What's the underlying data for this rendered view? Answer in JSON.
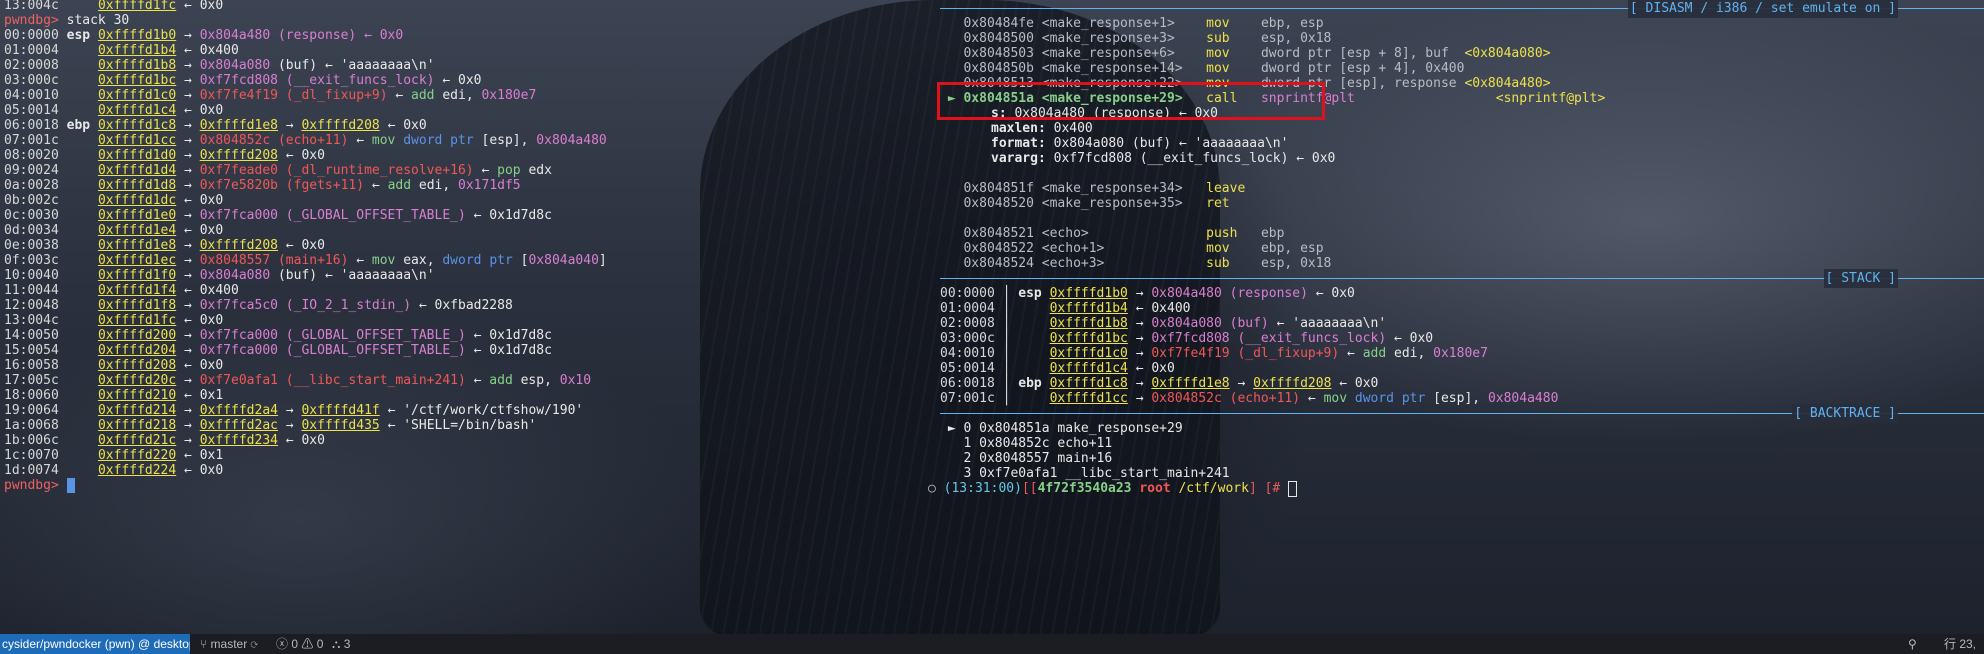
{
  "left_panel": {
    "top_line": {
      "idx": "13:004c",
      "addr": "0xffffd1fc",
      "rest": " ← 0x0"
    },
    "prompt": "pwndbg>",
    "command": " stack 30",
    "prompt2": "pwndbg>",
    "rows": [
      {
        "idx": "00:0000",
        "reg": "esp",
        "addr": "0xffffd1b0",
        "parts": [
          {
            "t": " → ",
            "c": "wf"
          },
          {
            "t": "0x804a480",
            "c": "pk"
          },
          {
            "t": " (response) ← 0x0",
            "c": "pk"
          }
        ]
      },
      {
        "idx": "01:0004",
        "reg": "",
        "addr": "0xffffd1b4",
        "parts": [
          {
            "t": " ← 0x400",
            "c": "wf"
          }
        ]
      },
      {
        "idx": "02:0008",
        "reg": "",
        "addr": "0xffffd1b8",
        "parts": [
          {
            "t": " → ",
            "c": "wf"
          },
          {
            "t": "0x804a080",
            "c": "pk"
          },
          {
            "t": " (buf) ← 'aaaaaaaa\\n'",
            "c": "wf"
          }
        ]
      },
      {
        "idx": "03:000c",
        "reg": "",
        "addr": "0xffffd1bc",
        "parts": [
          {
            "t": " → ",
            "c": "wf"
          },
          {
            "t": "0xf7fcd808 (__exit_funcs_lock)",
            "c": "pk"
          },
          {
            "t": " ← 0x0",
            "c": "wf"
          }
        ]
      },
      {
        "idx": "04:0010",
        "reg": "",
        "addr": "0xffffd1c0",
        "parts": [
          {
            "t": " → ",
            "c": "wf"
          },
          {
            "t": "0xf7fe4f19 (_dl_fixup+9)",
            "c": "rd"
          },
          {
            "t": " ← ",
            "c": "wf"
          },
          {
            "t": "add ",
            "c": "gn"
          },
          {
            "t": "edi, ",
            "c": "wf"
          },
          {
            "t": "0x180e7",
            "c": "pk"
          }
        ]
      },
      {
        "idx": "05:0014",
        "reg": "",
        "addr": "0xffffd1c4",
        "parts": [
          {
            "t": " ← 0x0",
            "c": "wf"
          }
        ]
      },
      {
        "idx": "06:0018",
        "reg": "ebp",
        "addr": "0xffffd1c8",
        "parts": [
          {
            "t": " → ",
            "c": "wf"
          },
          {
            "t": "0xffffd1e8",
            "c": "yl ul"
          },
          {
            "t": " → ",
            "c": "wf"
          },
          {
            "t": "0xffffd208",
            "c": "yl ul"
          },
          {
            "t": " ← 0x0",
            "c": "wf"
          }
        ]
      },
      {
        "idx": "07:001c",
        "reg": "",
        "addr": "0xffffd1cc",
        "parts": [
          {
            "t": " → ",
            "c": "wf"
          },
          {
            "t": "0x804852c (echo+11)",
            "c": "rd"
          },
          {
            "t": " ← ",
            "c": "wf"
          },
          {
            "t": "mov ",
            "c": "gn"
          },
          {
            "t": "dword ptr ",
            "c": "bl"
          },
          {
            "t": "[esp], ",
            "c": "wf"
          },
          {
            "t": "0x804a480",
            "c": "pk"
          }
        ]
      },
      {
        "idx": "08:0020",
        "reg": "",
        "addr": "0xffffd1d0",
        "parts": [
          {
            "t": " → ",
            "c": "wf"
          },
          {
            "t": "0xffffd208",
            "c": "yl ul"
          },
          {
            "t": " ← 0x0",
            "c": "wf"
          }
        ]
      },
      {
        "idx": "09:0024",
        "reg": "",
        "addr": "0xffffd1d4",
        "parts": [
          {
            "t": " → ",
            "c": "wf"
          },
          {
            "t": "0xf7feade0 (_dl_runtime_resolve+16)",
            "c": "rd"
          },
          {
            "t": " ← ",
            "c": "wf"
          },
          {
            "t": "pop ",
            "c": "gn"
          },
          {
            "t": "edx",
            "c": "wf"
          }
        ]
      },
      {
        "idx": "0a:0028",
        "reg": "",
        "addr": "0xffffd1d8",
        "parts": [
          {
            "t": " → ",
            "c": "wf"
          },
          {
            "t": "0xf7e5820b (fgets+11)",
            "c": "rd"
          },
          {
            "t": " ← ",
            "c": "wf"
          },
          {
            "t": "add ",
            "c": "gn"
          },
          {
            "t": "edi, ",
            "c": "wf"
          },
          {
            "t": "0x171df5",
            "c": "pk"
          }
        ]
      },
      {
        "idx": "0b:002c",
        "reg": "",
        "addr": "0xffffd1dc",
        "parts": [
          {
            "t": " ← 0x0",
            "c": "wf"
          }
        ]
      },
      {
        "idx": "0c:0030",
        "reg": "",
        "addr": "0xffffd1e0",
        "parts": [
          {
            "t": " → ",
            "c": "wf"
          },
          {
            "t": "0xf7fca000 (_GLOBAL_OFFSET_TABLE_)",
            "c": "pk"
          },
          {
            "t": " ← 0x1d7d8c",
            "c": "wf"
          }
        ]
      },
      {
        "idx": "0d:0034",
        "reg": "",
        "addr": "0xffffd1e4",
        "parts": [
          {
            "t": " ← 0x0",
            "c": "wf"
          }
        ]
      },
      {
        "idx": "0e:0038",
        "reg": "",
        "addr": "0xffffd1e8",
        "parts": [
          {
            "t": " → ",
            "c": "wf"
          },
          {
            "t": "0xffffd208",
            "c": "yl ul"
          },
          {
            "t": " ← 0x0",
            "c": "wf"
          }
        ]
      },
      {
        "idx": "0f:003c",
        "reg": "",
        "addr": "0xffffd1ec",
        "parts": [
          {
            "t": " → ",
            "c": "wf"
          },
          {
            "t": "0x8048557 (main+16)",
            "c": "rd"
          },
          {
            "t": " ← ",
            "c": "wf"
          },
          {
            "t": "mov ",
            "c": "gn"
          },
          {
            "t": "eax, ",
            "c": "wf"
          },
          {
            "t": "dword ptr ",
            "c": "bl"
          },
          {
            "t": "[",
            "c": "wf"
          },
          {
            "t": "0x804a040",
            "c": "pk"
          },
          {
            "t": "]",
            "c": "wf"
          }
        ]
      },
      {
        "idx": "10:0040",
        "reg": "",
        "addr": "0xffffd1f0",
        "parts": [
          {
            "t": " → ",
            "c": "wf"
          },
          {
            "t": "0x804a080",
            "c": "pk"
          },
          {
            "t": " (buf) ← 'aaaaaaaa\\n'",
            "c": "wf"
          }
        ]
      },
      {
        "idx": "11:0044",
        "reg": "",
        "addr": "0xffffd1f4",
        "parts": [
          {
            "t": " ← 0x400",
            "c": "wf"
          }
        ]
      },
      {
        "idx": "12:0048",
        "reg": "",
        "addr": "0xffffd1f8",
        "parts": [
          {
            "t": " → ",
            "c": "wf"
          },
          {
            "t": "0xf7fca5c0 (_IO_2_1_stdin_)",
            "c": "pk"
          },
          {
            "t": " ← 0xfbad2288",
            "c": "wf"
          }
        ]
      },
      {
        "idx": "13:004c",
        "reg": "",
        "addr": "0xffffd1fc",
        "parts": [
          {
            "t": " ← 0x0",
            "c": "wf"
          }
        ]
      },
      {
        "idx": "14:0050",
        "reg": "",
        "addr": "0xffffd200",
        "parts": [
          {
            "t": " → ",
            "c": "wf"
          },
          {
            "t": "0xf7fca000 (_GLOBAL_OFFSET_TABLE_)",
            "c": "pk"
          },
          {
            "t": " ← 0x1d7d8c",
            "c": "wf"
          }
        ]
      },
      {
        "idx": "15:0054",
        "reg": "",
        "addr": "0xffffd204",
        "parts": [
          {
            "t": " → ",
            "c": "wf"
          },
          {
            "t": "0xf7fca000 (_GLOBAL_OFFSET_TABLE_)",
            "c": "pk"
          },
          {
            "t": " ← 0x1d7d8c",
            "c": "wf"
          }
        ]
      },
      {
        "idx": "16:0058",
        "reg": "",
        "addr": "0xffffd208",
        "parts": [
          {
            "t": " ← 0x0",
            "c": "wf"
          }
        ]
      },
      {
        "idx": "17:005c",
        "reg": "",
        "addr": "0xffffd20c",
        "parts": [
          {
            "t": " → ",
            "c": "wf"
          },
          {
            "t": "0xf7e0afa1 (__libc_start_main+241)",
            "c": "rd"
          },
          {
            "t": " ← ",
            "c": "wf"
          },
          {
            "t": "add ",
            "c": "gn"
          },
          {
            "t": "esp, ",
            "c": "wf"
          },
          {
            "t": "0x10",
            "c": "pk"
          }
        ]
      },
      {
        "idx": "18:0060",
        "reg": "",
        "addr": "0xffffd210",
        "parts": [
          {
            "t": " ← 0x1",
            "c": "wf"
          }
        ]
      },
      {
        "idx": "19:0064",
        "reg": "",
        "addr": "0xffffd214",
        "parts": [
          {
            "t": " → ",
            "c": "wf"
          },
          {
            "t": "0xffffd2a4",
            "c": "yl ul"
          },
          {
            "t": " → ",
            "c": "wf"
          },
          {
            "t": "0xffffd41f",
            "c": "yl ul"
          },
          {
            "t": " ← '/ctf/work/ctfshow/190'",
            "c": "wf"
          }
        ]
      },
      {
        "idx": "1a:0068",
        "reg": "",
        "addr": "0xffffd218",
        "parts": [
          {
            "t": " → ",
            "c": "wf"
          },
          {
            "t": "0xffffd2ac",
            "c": "yl ul"
          },
          {
            "t": " → ",
            "c": "wf"
          },
          {
            "t": "0xffffd435",
            "c": "yl ul"
          },
          {
            "t": " ← 'SHELL=/bin/bash'",
            "c": "wf"
          }
        ]
      },
      {
        "idx": "1b:006c",
        "reg": "",
        "addr": "0xffffd21c",
        "parts": [
          {
            "t": " → ",
            "c": "wf"
          },
          {
            "t": "0xffffd234",
            "c": "yl ul"
          },
          {
            "t": " ← 0x0",
            "c": "wf"
          }
        ]
      },
      {
        "idx": "1c:0070",
        "reg": "",
        "addr": "0xffffd220",
        "parts": [
          {
            "t": " ← 0x1",
            "c": "wf"
          }
        ]
      },
      {
        "idx": "1d:0074",
        "reg": "",
        "addr": "0xffffd224",
        "parts": [
          {
            "t": " ← 0x0",
            "c": "wf"
          }
        ]
      }
    ]
  },
  "right_panel": {
    "disasm_header": "[ DISASM / i386 / set emulate on ]",
    "disasm_rows": [
      {
        "marker": "",
        "addr": "0x80484fe",
        "sym": "<make_response+1>",
        "mn": "mov",
        "ops": "ebp, esp",
        "tgt": "",
        "current": false
      },
      {
        "marker": "",
        "addr": "0x8048500",
        "sym": "<make_response+3>",
        "mn": "sub",
        "ops": "esp, 0x18",
        "tgt": "",
        "current": false
      },
      {
        "marker": "",
        "addr": "0x8048503",
        "sym": "<make_response+6>",
        "mn": "mov",
        "ops": "dword ptr [esp + 8], buf",
        "tgt": "<0x804a080>",
        "current": false
      },
      {
        "marker": "",
        "addr": "0x804850b",
        "sym": "<make_response+14>",
        "mn": "mov",
        "ops": "dword ptr [esp + 4], 0x400",
        "tgt": "",
        "current": false
      },
      {
        "marker": "",
        "addr": "0x8048513",
        "sym": "<make_response+22>",
        "mn": "mov",
        "ops": "dword ptr [esp], response",
        "tgt": "<0x804a480>",
        "current": false
      },
      {
        "marker": "►",
        "addr": "0x804851a",
        "sym": "<make_response+29>",
        "mn": "call",
        "ops": "snprintf@plt",
        "tgt": "<snprintf@plt>",
        "current": true
      }
    ],
    "call_args": [
      {
        "name": "s:",
        "val": " 0x804a480 (response) ← 0x0"
      },
      {
        "name": "maxlen:",
        "val": " 0x400"
      },
      {
        "name": "format:",
        "val": " 0x804a080 (buf) ← 'aaaaaaaa\\n'"
      },
      {
        "name": "vararg:",
        "val": " 0xf7fcd808 (__exit_funcs_lock) ← 0x0"
      }
    ],
    "disasm_rows2": [
      {
        "addr": "0x804851f",
        "sym": "<make_response+34>",
        "mn": "leave",
        "ops": ""
      },
      {
        "addr": "0x8048520",
        "sym": "<make_response+35>",
        "mn": "ret",
        "ops": ""
      }
    ],
    "disasm_rows3": [
      {
        "addr": "0x8048521",
        "sym": "<echo>",
        "mn": "push",
        "ops": "ebp"
      },
      {
        "addr": "0x8048522",
        "sym": "<echo+1>",
        "mn": "mov",
        "ops": "ebp, esp"
      },
      {
        "addr": "0x8048524",
        "sym": "<echo+3>",
        "mn": "sub",
        "ops": "esp, 0x18"
      }
    ],
    "stack_header": "[ STACK ]",
    "stack_rows": [
      {
        "idx": "00:0000",
        "reg": "esp",
        "addr": "0xffffd1b0",
        "parts": [
          {
            "t": " → ",
            "c": "wf"
          },
          {
            "t": "0x804a480 (response)",
            "c": "pk"
          },
          {
            "t": " ← 0x0",
            "c": "wf"
          }
        ]
      },
      {
        "idx": "01:0004",
        "reg": "",
        "addr": "0xffffd1b4",
        "parts": [
          {
            "t": " ← 0x400",
            "c": "wf"
          }
        ]
      },
      {
        "idx": "02:0008",
        "reg": "",
        "addr": "0xffffd1b8",
        "parts": [
          {
            "t": " → ",
            "c": "wf"
          },
          {
            "t": "0x804a080 (buf)",
            "c": "pk"
          },
          {
            "t": " ← 'aaaaaaaa\\n'",
            "c": "wf"
          }
        ]
      },
      {
        "idx": "03:000c",
        "reg": "",
        "addr": "0xffffd1bc",
        "parts": [
          {
            "t": " → ",
            "c": "wf"
          },
          {
            "t": "0xf7fcd808 (__exit_funcs_lock)",
            "c": "pk"
          },
          {
            "t": " ← 0x0",
            "c": "wf"
          }
        ]
      },
      {
        "idx": "04:0010",
        "reg": "",
        "addr": "0xffffd1c0",
        "parts": [
          {
            "t": " → ",
            "c": "wf"
          },
          {
            "t": "0xf7fe4f19 (_dl_fixup+9)",
            "c": "rd"
          },
          {
            "t": " ← ",
            "c": "wf"
          },
          {
            "t": "add ",
            "c": "gn"
          },
          {
            "t": "edi, ",
            "c": "wf"
          },
          {
            "t": "0x180e7",
            "c": "pk"
          }
        ]
      },
      {
        "idx": "05:0014",
        "reg": "",
        "addr": "0xffffd1c4",
        "parts": [
          {
            "t": " ← 0x0",
            "c": "wf"
          }
        ]
      },
      {
        "idx": "06:0018",
        "reg": "ebp",
        "addr": "0xffffd1c8",
        "parts": [
          {
            "t": " → ",
            "c": "wf"
          },
          {
            "t": "0xffffd1e8",
            "c": "yl ul"
          },
          {
            "t": " → ",
            "c": "wf"
          },
          {
            "t": "0xffffd208",
            "c": "yl ul"
          },
          {
            "t": " ← 0x0",
            "c": "wf"
          }
        ]
      },
      {
        "idx": "07:001c",
        "reg": "",
        "addr": "0xffffd1cc",
        "parts": [
          {
            "t": " → ",
            "c": "wf"
          },
          {
            "t": "0x804852c (echo+11)",
            "c": "rd"
          },
          {
            "t": " ← ",
            "c": "wf"
          },
          {
            "t": "mov ",
            "c": "gn"
          },
          {
            "t": "dword ptr ",
            "c": "bl"
          },
          {
            "t": "[esp], ",
            "c": "wf"
          },
          {
            "t": "0x804a480",
            "c": "pk"
          }
        ]
      }
    ],
    "backtrace_header": "[ BACKTRACE ]",
    "backtrace": [
      {
        "marker": "►",
        "num": "0",
        "addr": "0x804851a",
        "fn": "make_response+29"
      },
      {
        "marker": "",
        "num": "1",
        "addr": "0x804852c",
        "fn": "echo+11"
      },
      {
        "marker": "",
        "num": "2",
        "addr": "0x8048557",
        "fn": "main+16"
      },
      {
        "marker": "",
        "num": "3",
        "addr": "0xf7e0afa1",
        "fn": "__libc_start_main+241"
      }
    ],
    "shell": {
      "time": "(13:31:00)",
      "host": "4f72f3540a23",
      "user": "root",
      "path": "/ctf/work",
      "suffix": "[#"
    }
  },
  "status_bar": {
    "remote": "cysider/pwndocker (pwn) @ desktop-li...",
    "branch": "master",
    "errors": "0",
    "warnings": "0",
    "ports": "3",
    "right_text": "行 23,"
  },
  "colors": {
    "accent": "#1e6bb8",
    "highlight_box": "#e0111b"
  }
}
